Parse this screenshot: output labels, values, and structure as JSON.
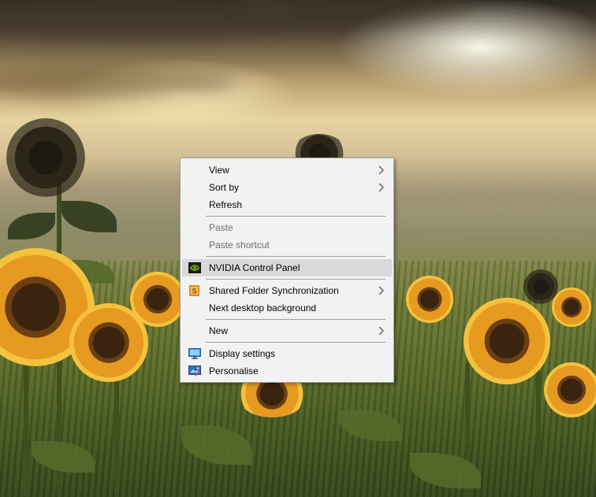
{
  "desktop": {
    "wallpaper": "sunflower-field-sunset"
  },
  "context_menu": {
    "items": [
      {
        "label": "View",
        "submenu": true,
        "enabled": true
      },
      {
        "label": "Sort by",
        "submenu": true,
        "enabled": true
      },
      {
        "label": "Refresh",
        "submenu": false,
        "enabled": true
      },
      {
        "label": "Paste",
        "submenu": false,
        "enabled": false
      },
      {
        "label": "Paste shortcut",
        "submenu": false,
        "enabled": false
      },
      {
        "label": "NVIDIA Control Panel",
        "submenu": false,
        "enabled": true,
        "icon": "nvidia-icon",
        "highlighted": true
      },
      {
        "label": "Shared Folder Synchronization",
        "submenu": true,
        "enabled": true,
        "icon": "sync-s-icon"
      },
      {
        "label": "Next desktop background",
        "submenu": false,
        "enabled": true
      },
      {
        "label": "New",
        "submenu": true,
        "enabled": true
      },
      {
        "label": "Display settings",
        "submenu": false,
        "enabled": true,
        "icon": "display-icon"
      },
      {
        "label": "Personalise",
        "submenu": false,
        "enabled": true,
        "icon": "personalise-icon"
      }
    ]
  },
  "colors": {
    "menu_background": "#f2f2f2",
    "menu_border": "#a0a0a0",
    "highlight": "#d9d9d9",
    "disabled_text": "#6d6d6d",
    "nvidia_green": "#76b900",
    "sync_orange": "#e08a1e"
  }
}
